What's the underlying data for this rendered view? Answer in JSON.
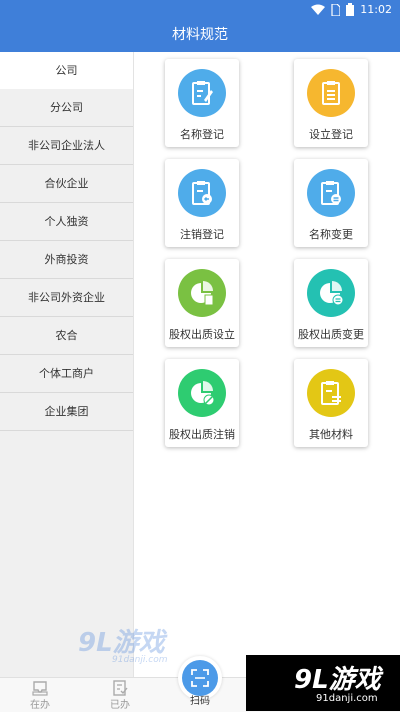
{
  "status_bar": {
    "time": "11:02"
  },
  "app_bar": {
    "title": "材料规范"
  },
  "sidebar": {
    "items": [
      {
        "label": "公司",
        "active": true
      },
      {
        "label": "分公司"
      },
      {
        "label": "非公司企业法人"
      },
      {
        "label": "合伙企业"
      },
      {
        "label": "个人独资"
      },
      {
        "label": "外商投资"
      },
      {
        "label": "非公司外资企业"
      },
      {
        "label": "农合"
      },
      {
        "label": "个体工商户"
      },
      {
        "label": "企业集团"
      }
    ]
  },
  "grid": {
    "items": [
      {
        "label": "名称登记",
        "color": "#4facea",
        "icon": "clipboard-pen-icon"
      },
      {
        "label": "设立登记",
        "color": "#f6b72f",
        "icon": "clipboard-list-icon"
      },
      {
        "label": "注销登记",
        "color": "#4facea",
        "icon": "clipboard-back-icon"
      },
      {
        "label": "名称变更",
        "color": "#4facea",
        "icon": "clipboard-swap-icon"
      },
      {
        "label": "股权出质设立",
        "color": "#7ac142",
        "icon": "pie-doc-icon"
      },
      {
        "label": "股权出质变更",
        "color": "#24c1b2",
        "icon": "pie-swap-icon"
      },
      {
        "label": "股权出质注销",
        "color": "#2ecc71",
        "icon": "pie-cancel-icon"
      },
      {
        "label": "其他材料",
        "color": "#e3c715",
        "icon": "clipboard-lines-icon"
      }
    ]
  },
  "bottom_bar": {
    "tabs": [
      {
        "label": "在办",
        "icon": "inbox-icon"
      },
      {
        "label": "已办",
        "icon": "done-list-icon"
      }
    ],
    "scan_label": "扫码"
  },
  "watermarks": {
    "left_big": "9L游戏",
    "left_small": "91danji.com",
    "right_big": "9L游戏",
    "right_small": "91danji.com"
  }
}
